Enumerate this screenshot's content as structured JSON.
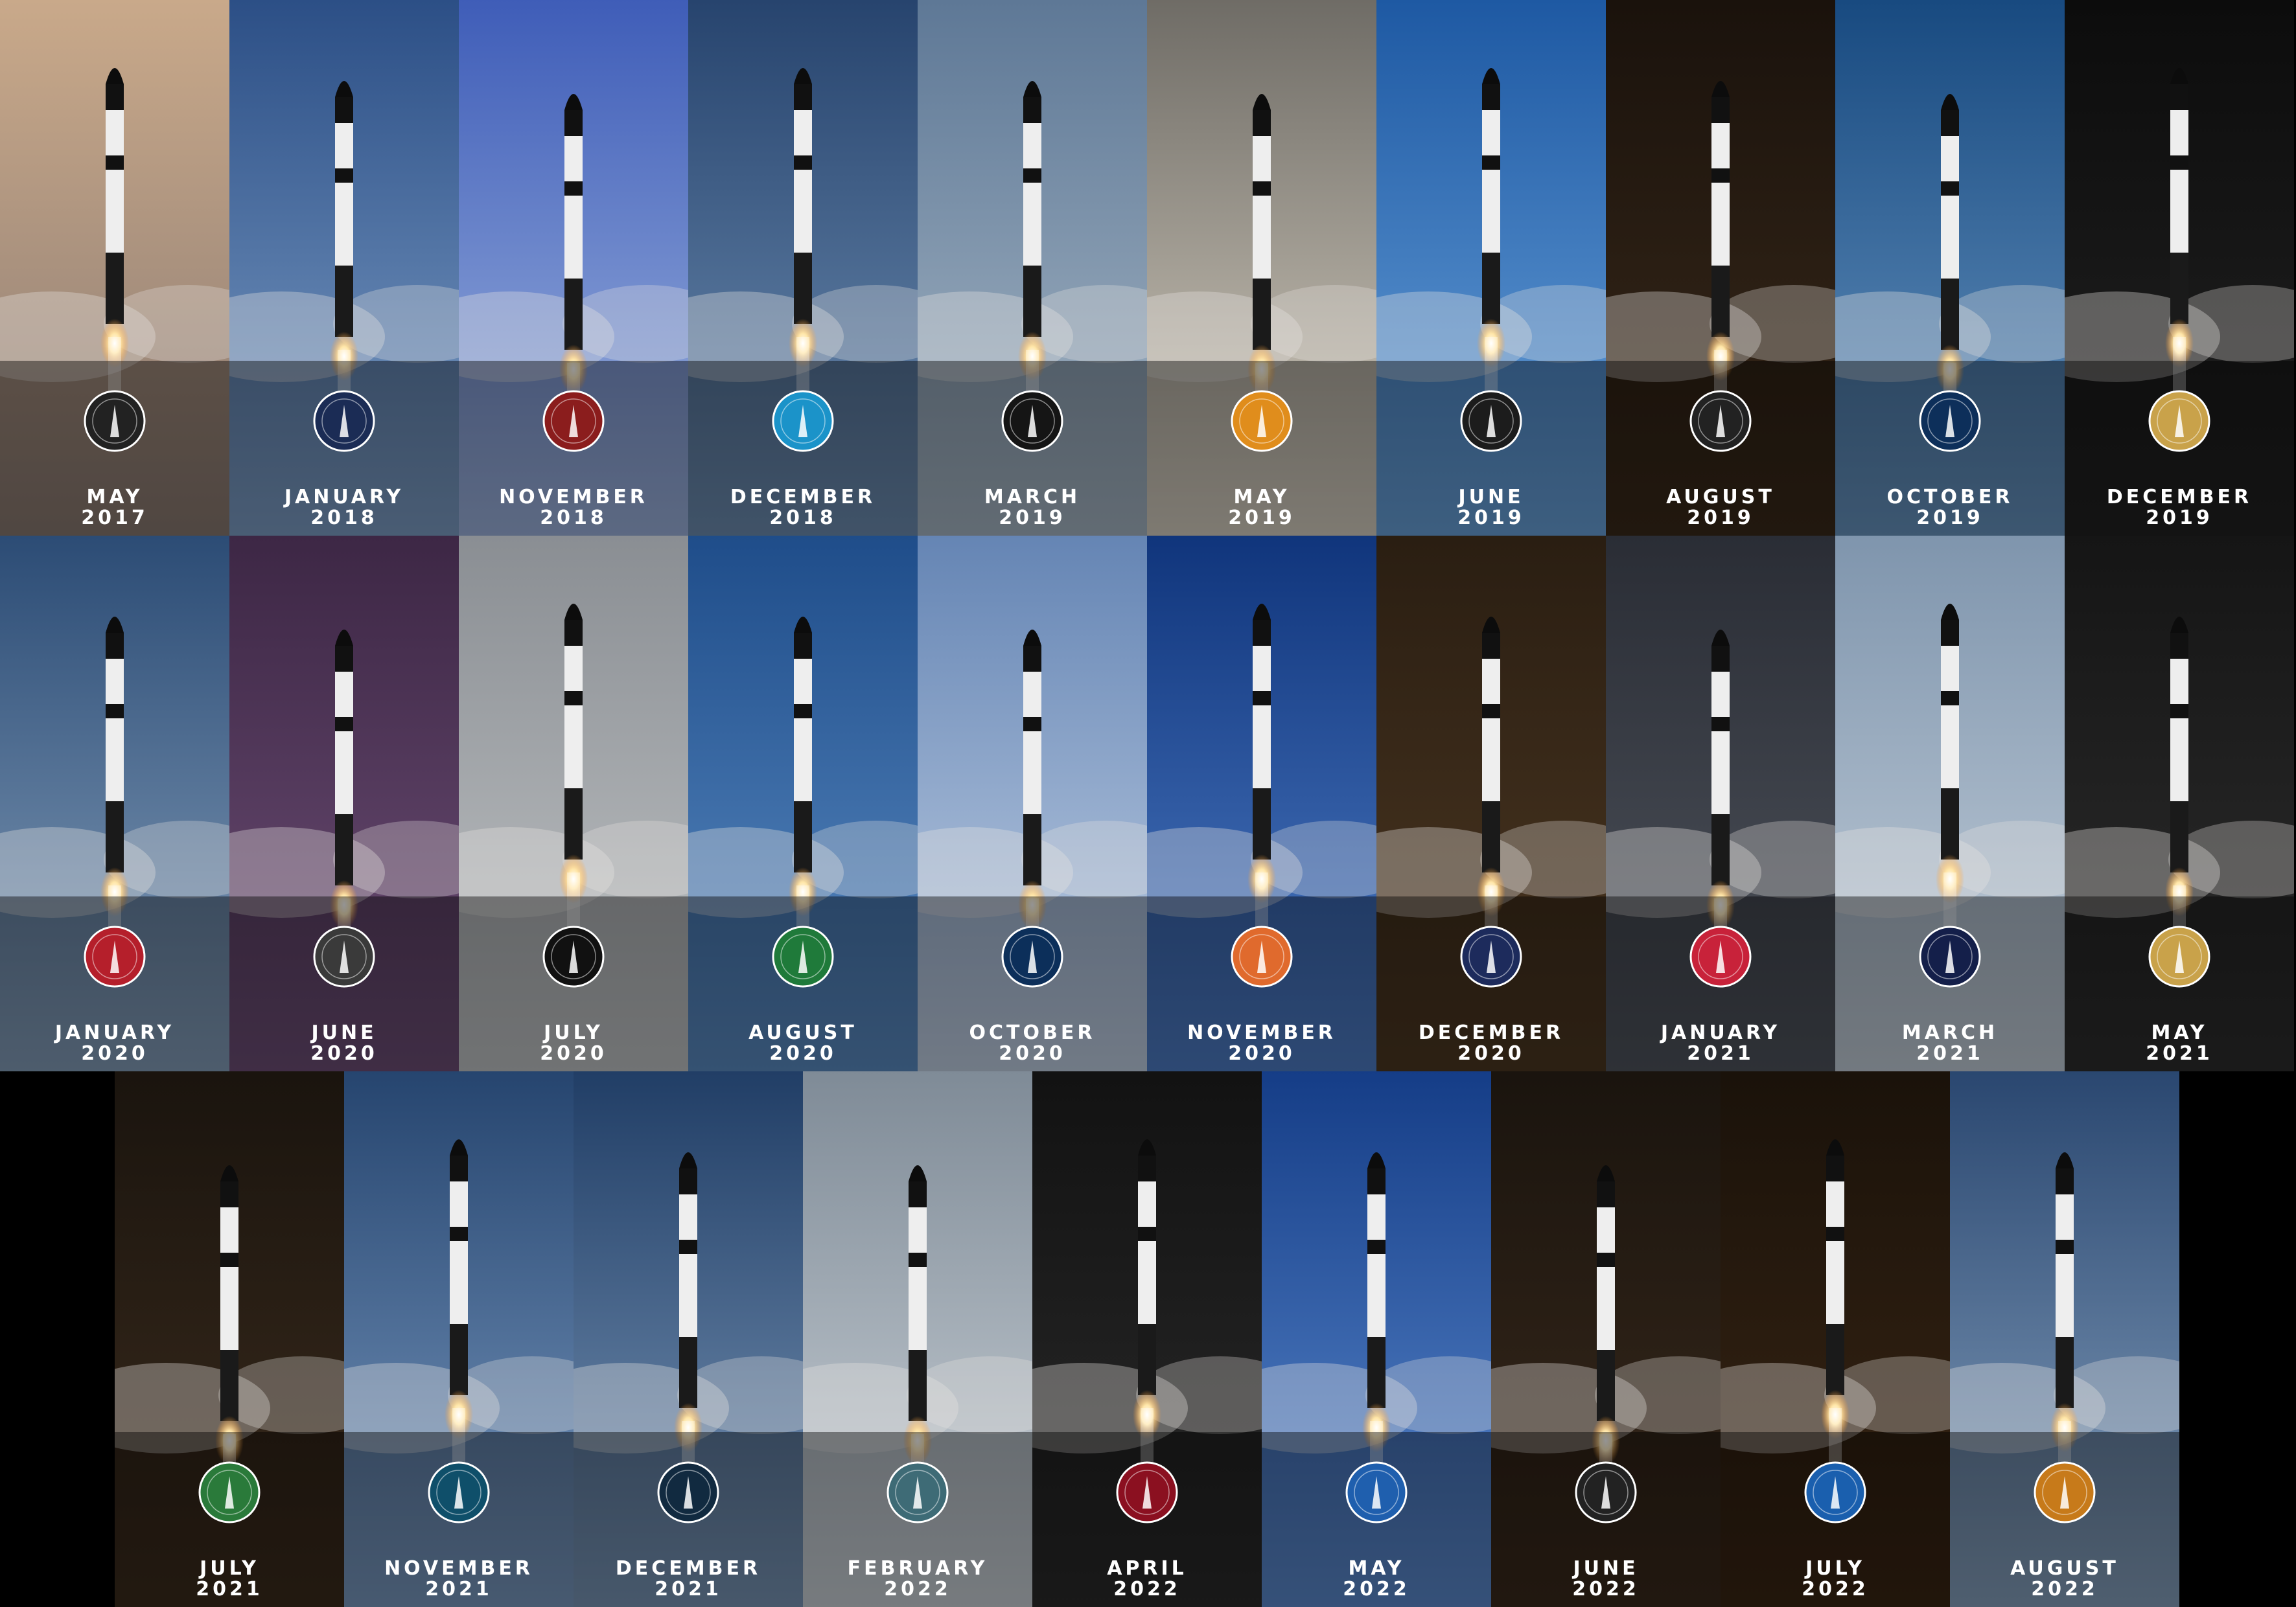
{
  "missions": [
    {
      "month": "MAY",
      "year": "2017",
      "sky": [
        "#c9a98a",
        "#8a7a72"
      ],
      "badge": "#222222"
    },
    {
      "month": "JANUARY",
      "year": "2018",
      "sky": [
        "#2c4f86",
        "#7fa0c8"
      ],
      "badge": "#1b2c55"
    },
    {
      "month": "NOVEMBER",
      "year": "2018",
      "sky": [
        "#3f5db8",
        "#9fb5e0"
      ],
      "badge": "#8b1d1d"
    },
    {
      "month": "DECEMBER",
      "year": "2018",
      "sky": [
        "#27446e",
        "#6f8fb3"
      ],
      "badge": "#1b93c9"
    },
    {
      "month": "MARCH",
      "year": "2019",
      "sky": [
        "#5e7896",
        "#a9b9c7"
      ],
      "badge": "#151515"
    },
    {
      "month": "MAY",
      "year": "2019",
      "sky": [
        "#6f6c66",
        "#d9d2c4"
      ],
      "badge": "#e08d1c"
    },
    {
      "month": "JUNE",
      "year": "2019",
      "sky": [
        "#1e59a3",
        "#6aa3dc"
      ],
      "badge": "#1c1c1c"
    },
    {
      "month": "AUGUST",
      "year": "2019",
      "sky": [
        "#1a120c",
        "#3a2a1a"
      ],
      "badge": "#222222"
    },
    {
      "month": "OCTOBER",
      "year": "2019",
      "sky": [
        "#184a80",
        "#6996c2"
      ],
      "badge": "#0d2f5a"
    },
    {
      "month": "DECEMBER",
      "year": "2019",
      "sky": [
        "#0c0c0c",
        "#222222"
      ],
      "badge": "#c9a24a"
    },
    {
      "month": "JANUARY",
      "year": "2020",
      "sky": [
        "#2c4c75",
        "#86a0bc"
      ],
      "badge": "#b51f2b"
    },
    {
      "month": "JUNE",
      "year": "2020",
      "sky": [
        "#3d2745",
        "#6e4f77"
      ],
      "badge": "#3a3a3a"
    },
    {
      "month": "JULY",
      "year": "2020",
      "sky": [
        "#8a8e93",
        "#c3c6c8"
      ],
      "badge": "#111111"
    },
    {
      "month": "AUGUST",
      "year": "2020",
      "sky": [
        "#1f4d8a",
        "#5c8dc4"
      ],
      "badge": "#1f7a3a"
    },
    {
      "month": "OCTOBER",
      "year": "2020",
      "sky": [
        "#6585b4",
        "#c3d2e6"
      ],
      "badge": "#0c2f5a"
    },
    {
      "month": "NOVEMBER",
      "year": "2020",
      "sky": [
        "#10357c",
        "#4f7ec7"
      ],
      "badge": "#e06a2d"
    },
    {
      "month": "DECEMBER",
      "year": "2020",
      "sky": [
        "#2a1e12",
        "#4d3822"
      ],
      "badge": "#1d2b5c"
    },
    {
      "month": "JANUARY",
      "year": "2021",
      "sky": [
        "#2a2d35",
        "#50555e"
      ],
      "badge": "#c8223a"
    },
    {
      "month": "MARCH",
      "year": "2021",
      "sky": [
        "#7f95ad",
        "#c6d1dc"
      ],
      "badge": "#141f4a"
    },
    {
      "month": "MAY",
      "year": "2021",
      "sky": [
        "#151515",
        "#2e2e2e"
      ],
      "badge": "#c9a24a"
    },
    {
      "month": "JULY",
      "year": "2021",
      "sky": [
        "#1a140e",
        "#3c2c1d"
      ],
      "badge": "#2a7a3a"
    },
    {
      "month": "NOVEMBER",
      "year": "2021",
      "sky": [
        "#26456f",
        "#7b9bc2"
      ],
      "badge": "#0f4f6a"
    },
    {
      "month": "DECEMBER",
      "year": "2021",
      "sky": [
        "#213e66",
        "#7b98b9"
      ],
      "badge": "#112a40"
    },
    {
      "month": "FEBRUARY",
      "year": "2022",
      "sky": [
        "#7f8b97",
        "#cdd4da"
      ],
      "badge": "#3e6b76"
    },
    {
      "month": "APRIL",
      "year": "2022",
      "sky": [
        "#121212",
        "#2b2b2b"
      ],
      "badge": "#8b1020"
    },
    {
      "month": "MAY",
      "year": "2022",
      "sky": [
        "#153d87",
        "#5d8cd0"
      ],
      "badge": "#1f5fae"
    },
    {
      "month": "JUNE",
      "year": "2022",
      "sky": [
        "#1a140e",
        "#3a2a1c"
      ],
      "badge": "#222222"
    },
    {
      "month": "JULY",
      "year": "2022",
      "sky": [
        "#1a120a",
        "#3a2614"
      ],
      "badge": "#1a5fae"
    },
    {
      "month": "AUGUST",
      "year": "2022",
      "sky": [
        "#2a4770",
        "#88a3c0"
      ],
      "badge": "#c77a1a"
    }
  ]
}
